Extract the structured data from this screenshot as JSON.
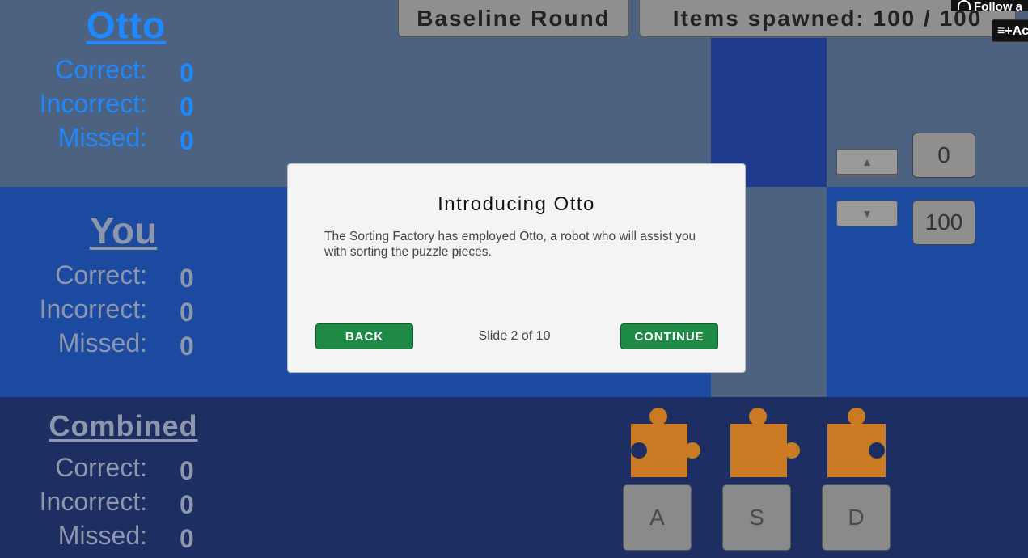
{
  "otto": {
    "title": "Otto",
    "correct_label": "Correct:",
    "correct": "0",
    "incorrect_label": "Incorrect:",
    "incorrect": "0",
    "missed_label": "Missed:",
    "missed": "0"
  },
  "you": {
    "title": "You",
    "correct_label": "Correct:",
    "correct": "0",
    "incorrect_label": "Incorrect:",
    "incorrect": "0",
    "missed_label": "Missed:",
    "missed": "0"
  },
  "combined": {
    "title": "Combined",
    "correct_label": "Correct:",
    "correct": "0",
    "incorrect_label": "Incorrect:",
    "incorrect": "0",
    "missed_label": "Missed:",
    "missed": "0"
  },
  "header": {
    "round": "Baseline Round",
    "spawned": "Items spawned: 100 / 100"
  },
  "overlay": {
    "follow": "Follow a",
    "add": "Ac"
  },
  "controls": {
    "up": "▲",
    "down": "▼",
    "min_value": "0",
    "max_value": "100"
  },
  "keys": [
    "A",
    "S",
    "D"
  ],
  "modal": {
    "title": "Introducing Otto",
    "body": "The Sorting Factory has employed Otto, a robot who will assist you with sorting the puzzle pieces.",
    "back": "BACK",
    "counter": "Slide 2 of 10",
    "continue": "CONTINUE"
  },
  "colors": {
    "piece": "#c97a22",
    "otto_text": "#1e88ff",
    "button_green": "#1e8a45"
  }
}
